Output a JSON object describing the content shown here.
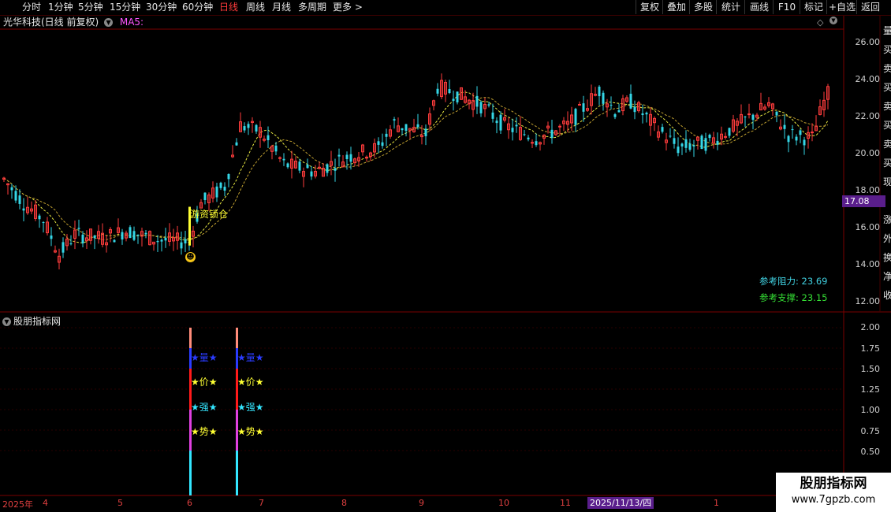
{
  "topbar": {
    "periods": [
      "分时",
      "1分钟",
      "5分钟",
      "15分钟",
      "30分钟",
      "60分钟",
      "日线",
      "周线",
      "月线",
      "多周期",
      "更多 >"
    ],
    "active_period": "日线",
    "buttons": [
      "复权",
      "叠加",
      "多股",
      "统计",
      "画线",
      "F10",
      "标记",
      "+自选",
      "返回"
    ]
  },
  "header": {
    "stock_name": "光华科技(日线 前复权)",
    "indicator": "MA5:"
  },
  "main_chart": {
    "price_axis": [
      "26.00",
      "24.00",
      "22.00",
      "20.00",
      "18.00",
      "16.00",
      "14.00",
      "12.00"
    ],
    "current_price": "17.08",
    "signal_label": "游资锁仓",
    "resistance_label": "参考阻力:",
    "resistance_value": "23.69",
    "support_label": "参考支撑:",
    "support_value": "23.15",
    "colors": {
      "up": "#ff3c3c",
      "down": "#35d6e6",
      "ma1": "#e6e640",
      "ma2": "#c0a030",
      "bg": "#000000",
      "grid": "#7a0000"
    }
  },
  "sub_chart": {
    "title": "股朋指标网",
    "axis": [
      "2.00",
      "1.75",
      "1.50",
      "1.25",
      "1.00",
      "0.75",
      "0.50"
    ],
    "labels": [
      "★量★",
      "★价★",
      "★强★",
      "★势★"
    ]
  },
  "date_axis": {
    "labels": [
      "2025年",
      "4",
      "5",
      "6",
      "7",
      "8",
      "9",
      "10",
      "11",
      "1"
    ],
    "cursor_date": "2025/11/13/四"
  },
  "right_panel_chars": [
    "量",
    "买",
    "卖",
    "买",
    "卖",
    "买",
    "卖",
    "买",
    "现",
    "涨",
    "外",
    "换",
    "净",
    "收"
  ],
  "watermark": {
    "title": "股朋指标网",
    "url": "www.7gpzb.com"
  }
}
